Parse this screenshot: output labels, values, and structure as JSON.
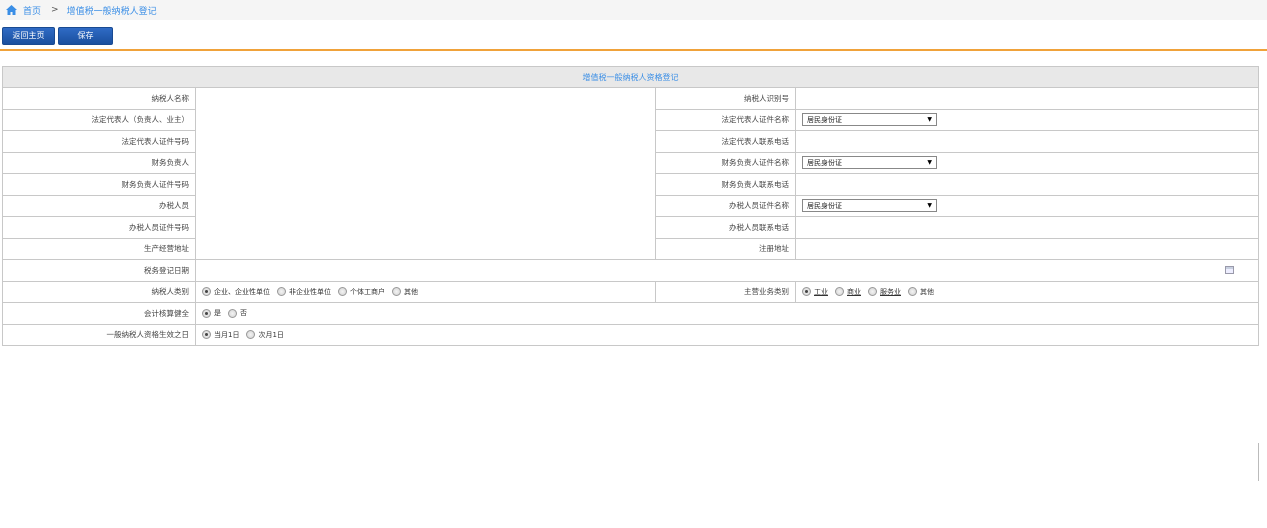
{
  "breadcrumb": {
    "home": "首页",
    "separator": ">",
    "current": "增值税一般纳税人登记"
  },
  "toolbar": {
    "back_home": "返回主页",
    "save": "保存"
  },
  "form": {
    "title": "增值税一般纳税人资格登记",
    "rows": {
      "taxpayer_name": "纳税人名称",
      "taxpayer_id": "纳税人识别号",
      "legal_rep": "法定代表人（负责人、业主）",
      "legal_rep_cert_name": "法定代表人证件名称",
      "legal_rep_cert_no": "法定代表人证件号码",
      "legal_rep_phone": "法定代表人联系电话",
      "finance_head": "财务负责人",
      "finance_cert_name": "财务负责人证件名称",
      "finance_cert_no": "财务负责人证件号码",
      "finance_phone": "财务负责人联系电话",
      "tax_officer": "办税人员",
      "tax_officer_cert_name": "办税人员证件名称",
      "tax_officer_cert_no": "办税人员证件号码",
      "tax_officer_phone": "办税人员联系电话",
      "business_address": "生产经营地址",
      "registered_address": "注册地址",
      "tax_reg_date": "税务登记日期",
      "taxpayer_type": "纳税人类别",
      "main_business": "主营业务类别",
      "accounting_sound": "会计核算健全",
      "effective_date": "一般纳税人资格生效之日"
    },
    "cert_select_value": "居民身份证",
    "taxpayer_type_options": [
      "企业、企业性单位",
      "非企业性单位",
      "个体工商户",
      "其他"
    ],
    "main_business_options": [
      "工业",
      "商业",
      "服务业",
      "其他"
    ],
    "accounting_options": [
      "是",
      "否"
    ],
    "effective_options": [
      "当月1日",
      "次月1日"
    ]
  }
}
